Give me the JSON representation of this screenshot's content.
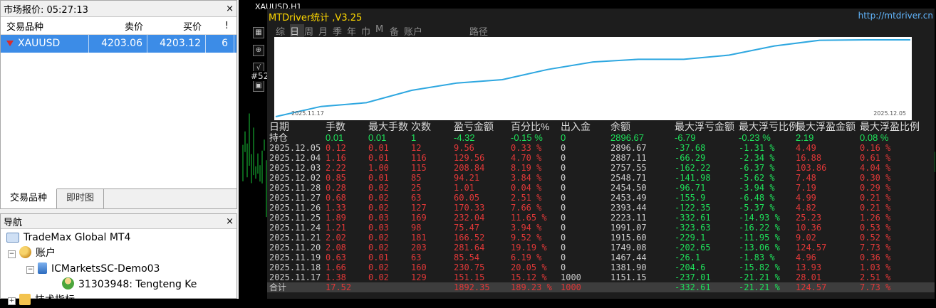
{
  "market_watch": {
    "title": "市场报价: 05:27:13",
    "close": "×",
    "columns": [
      "交易品种",
      "卖价",
      "买价",
      "!"
    ],
    "symbol": {
      "name": "XAUUSD",
      "bid": "4203.06",
      "ask": "4203.12",
      "spread": "6"
    },
    "tabs": [
      "交易品种",
      "即时图"
    ]
  },
  "navigator": {
    "title": "导航",
    "close": "×",
    "items": [
      {
        "label": "TradeMax Global MT4"
      },
      {
        "label": "账户"
      },
      {
        "label": "ICMarketsSC-Demo03"
      },
      {
        "label": "31303948: Tengteng Ke"
      },
      {
        "label": "技术指标"
      }
    ]
  },
  "chart": {
    "title": "XAUUSD,H1",
    "hstrip": "#52",
    "tool_icons": [
      "chart-bars-icon",
      "zoom-icon",
      "vertical-line-icon",
      "toolbox-icon"
    ]
  },
  "stats": {
    "title": "MTDriver统计 ,V3.25",
    "url": "http://mtdriver.cn",
    "tabs": [
      "综",
      "日",
      "周",
      "月",
      "季",
      "年",
      "巾",
      "M",
      "备",
      "账户",
      "路径"
    ],
    "equity": {
      "start_label": "2025.11.17",
      "end_label": "2025.12.05",
      "points": [
        1151.15,
        1381.9,
        1467.44,
        1749.08,
        1915.6,
        1991.07,
        2223.11,
        2393.44,
        2453.49,
        2454.5,
        2548.71,
        2757.55,
        2887.11,
        2896.67,
        2896.67
      ]
    },
    "headers": [
      "日期",
      "手数",
      "最大手数",
      "次数",
      "盈亏金额",
      "百分比%",
      "出入金",
      "余额",
      "最大浮亏金额",
      "最大浮亏比例",
      "最大浮盈金额",
      "最大浮盈比例"
    ],
    "holding": [
      "持仓",
      "0.01",
      "0.01",
      "1",
      "-4.32",
      "-0.15 %",
      "0",
      "2896.67",
      "-6.79",
      "-0.23 %",
      "2.19",
      "0.08 %"
    ],
    "rows": [
      [
        "2025.12.05",
        "0.12",
        "0.01",
        "12",
        "9.56",
        "0.33 %",
        "0",
        "2896.67",
        "-37.68",
        "-1.31 %",
        "4.49",
        "0.16 %"
      ],
      [
        "2025.12.04",
        "1.16",
        "0.01",
        "116",
        "129.56",
        "4.70 %",
        "0",
        "2887.11",
        "-66.29",
        "-2.34 %",
        "16.88",
        "0.61 %"
      ],
      [
        "2025.12.03",
        "2.22",
        "1.00",
        "115",
        "208.84",
        "8.19 %",
        "0",
        "2757.55",
        "-162.22",
        "-6.37 %",
        "103.86",
        "4.04 %"
      ],
      [
        "2025.12.02",
        "0.85",
        "0.01",
        "85",
        "94.21",
        "3.84 %",
        "0",
        "2548.71",
        "-141.98",
        "-5.62 %",
        "7.48",
        "0.30 %"
      ],
      [
        "2025.11.28",
        "0.28",
        "0.02",
        "25",
        "1.01",
        "0.04 %",
        "0",
        "2454.50",
        "-96.71",
        "-3.94 %",
        "7.19",
        "0.29 %"
      ],
      [
        "2025.11.27",
        "0.68",
        "0.02",
        "63",
        "60.05",
        "2.51 %",
        "0",
        "2453.49",
        "-155.9",
        "-6.48 %",
        "4.99",
        "0.21 %"
      ],
      [
        "2025.11.26",
        "1.33",
        "0.02",
        "127",
        "170.33",
        "7.66 %",
        "0",
        "2393.44",
        "-122.35",
        "-5.37 %",
        "4.82",
        "0.21 %"
      ],
      [
        "2025.11.25",
        "1.89",
        "0.03",
        "169",
        "232.04",
        "11.65 %",
        "0",
        "2223.11",
        "-332.61",
        "-14.93 %",
        "25.23",
        "1.26 %"
      ],
      [
        "2025.11.24",
        "1.21",
        "0.03",
        "98",
        "75.47",
        "3.94 %",
        "0",
        "1991.07",
        "-323.63",
        "-16.22 %",
        "10.36",
        "0.53 %"
      ],
      [
        "2025.11.21",
        "2.02",
        "0.02",
        "181",
        "166.52",
        "9.52 %",
        "0",
        "1915.60",
        "-229.1",
        "-11.95 %",
        "9.02",
        "0.52 %"
      ],
      [
        "2025.11.20",
        "2.08",
        "0.02",
        "203",
        "281.64",
        "19.19 %",
        "0",
        "1749.08",
        "-202.65",
        "-13.06 %",
        "124.57",
        "7.73 %"
      ],
      [
        "2025.11.19",
        "0.63",
        "0.01",
        "63",
        "85.54",
        "6.19 %",
        "0",
        "1467.44",
        "-26.1",
        "-1.83 %",
        "4.96",
        "0.36 %"
      ],
      [
        "2025.11.18",
        "1.66",
        "0.02",
        "160",
        "230.75",
        "20.05 %",
        "0",
        "1381.90",
        "-204.6",
        "-15.82 %",
        "13.93",
        "1.03 %"
      ],
      [
        "2025.11.17",
        "1.38",
        "0.02",
        "129",
        "151.15",
        "15.12 %",
        "1000",
        "1151.15",
        "-237.01",
        "-21.21 %",
        "28.01",
        "2.51 %"
      ]
    ],
    "total": [
      "合计",
      "17.52",
      "",
      "",
      "1892.35",
      "189.23 %",
      "1000",
      "",
      "-332.61",
      "-21.21 %",
      "124.57",
      "7.73 %"
    ]
  }
}
